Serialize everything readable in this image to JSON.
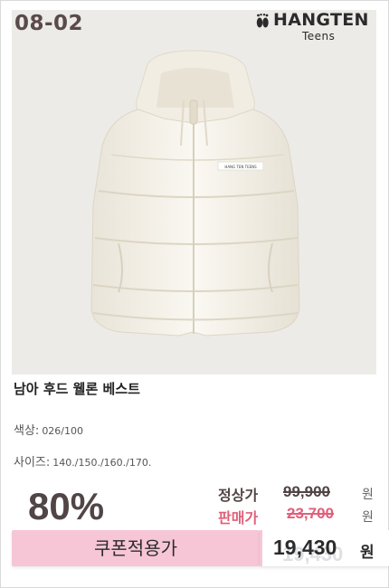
{
  "product": {
    "code": "08-02",
    "brand": "HANGTEN",
    "brand_sub": "Teens",
    "garment_tag": "HANG TEN TEENS",
    "title": "남아 후드 웰론 베스트",
    "color_label": "색상",
    "color_value": "026/100",
    "size_label": "사이즈",
    "size_value": "140./150./160./170.",
    "colon": ":"
  },
  "pricing": {
    "discount_rate": "80%",
    "regular_label": "정상가",
    "regular_price": "99,900",
    "sale_label": "판매가",
    "sale_price": "23,700",
    "currency_unit": "원",
    "coupon_label": "쿠폰적용가",
    "final_price": "19,430",
    "final_unit": "원"
  },
  "colors": {
    "photo_background": "#ecebe7",
    "vest": "#f7f4ec",
    "coupon_bar": "#f6c6d6",
    "sale_accent": "#e0607b",
    "text_dark": "#514546"
  },
  "icons": {
    "logo_mark": "footprint-icon"
  }
}
